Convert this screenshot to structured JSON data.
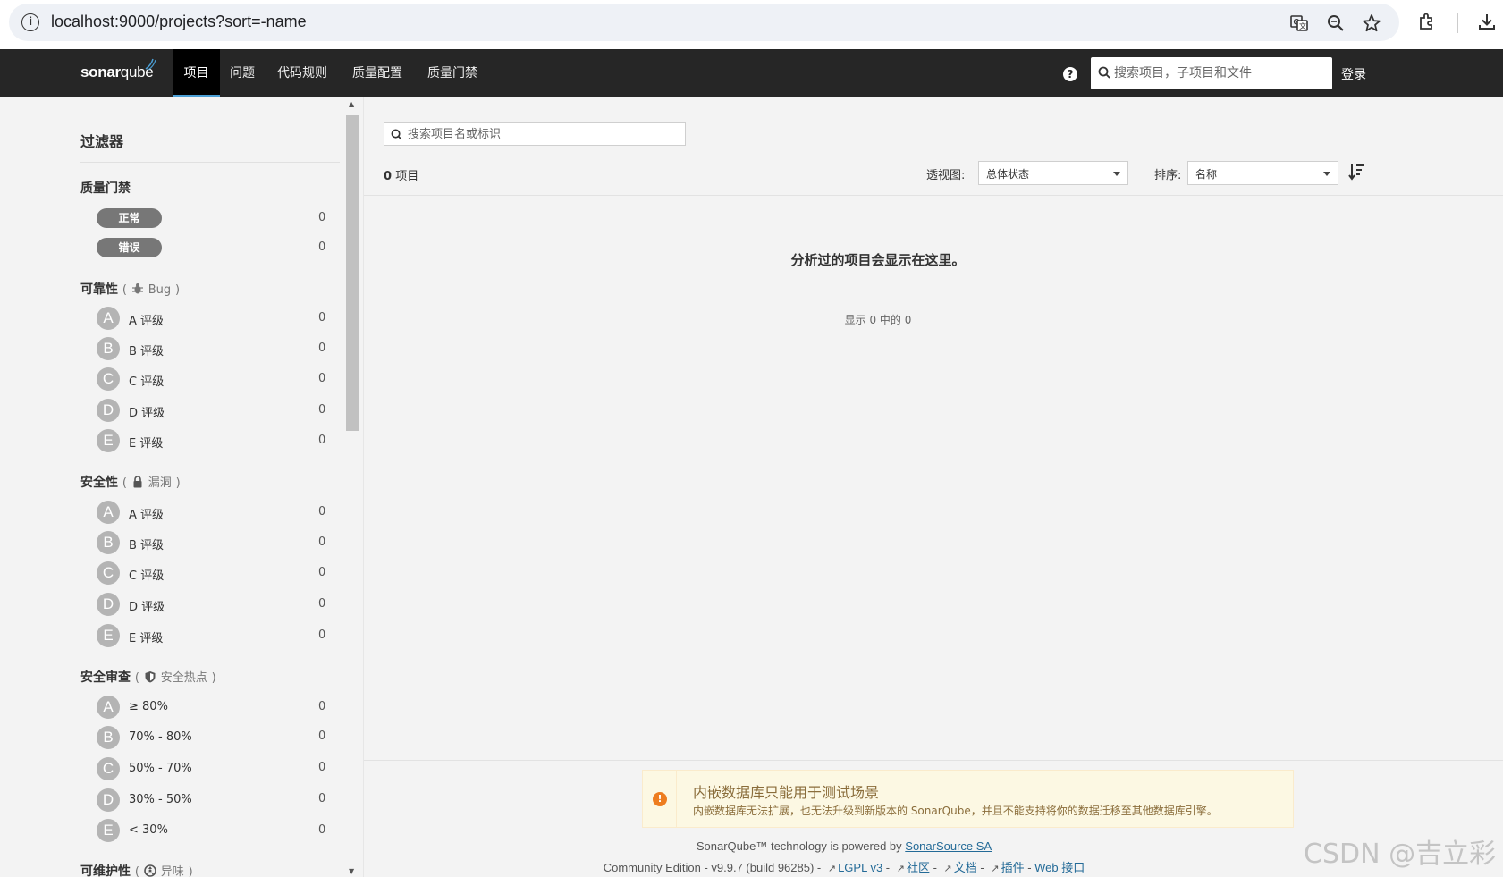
{
  "browser": {
    "url": "localhost:9000/projects?sort=-name"
  },
  "nav": {
    "logo_a": "sonar",
    "logo_b": "qube",
    "items": [
      {
        "label": "项目"
      },
      {
        "label": "问题"
      },
      {
        "label": "代码规则"
      },
      {
        "label": "质量配置"
      },
      {
        "label": "质量门禁"
      }
    ],
    "help": "?",
    "search_placeholder": "搜索项目，子项目和文件",
    "login": "登录"
  },
  "sidebar": {
    "title": "过滤器",
    "quality_gate": {
      "title": "质量门禁",
      "items": [
        {
          "label": "正常",
          "count": "0"
        },
        {
          "label": "错误",
          "count": "0"
        }
      ]
    },
    "reliability": {
      "title": "可靠性",
      "paren_open": "(",
      "sub": "Bug",
      "paren_close": ")",
      "items": [
        {
          "grade": "A",
          "label": "A 评级",
          "count": "0"
        },
        {
          "grade": "B",
          "label": "B 评级",
          "count": "0"
        },
        {
          "grade": "C",
          "label": "C 评级",
          "count": "0"
        },
        {
          "grade": "D",
          "label": "D 评级",
          "count": "0"
        },
        {
          "grade": "E",
          "label": "E 评级",
          "count": "0"
        }
      ]
    },
    "security": {
      "title": "安全性",
      "paren_open": "(",
      "sub": "漏洞",
      "paren_close": ")",
      "items": [
        {
          "grade": "A",
          "label": "A 评级",
          "count": "0"
        },
        {
          "grade": "B",
          "label": "B 评级",
          "count": "0"
        },
        {
          "grade": "C",
          "label": "C 评级",
          "count": "0"
        },
        {
          "grade": "D",
          "label": "D 评级",
          "count": "0"
        },
        {
          "grade": "E",
          "label": "E 评级",
          "count": "0"
        }
      ]
    },
    "security_review": {
      "title": "安全审查",
      "paren_open": "(",
      "sub": "安全热点",
      "paren_close": ")",
      "items": [
        {
          "grade": "A",
          "label": "≥ 80%",
          "count": "0"
        },
        {
          "grade": "B",
          "label": "70% - 80%",
          "count": "0"
        },
        {
          "grade": "C",
          "label": "50% - 70%",
          "count": "0"
        },
        {
          "grade": "D",
          "label": "30% - 50%",
          "count": "0"
        },
        {
          "grade": "E",
          "label": "< 30%",
          "count": "0"
        }
      ]
    },
    "maintainability": {
      "title": "可维护性",
      "paren_open": "(",
      "sub": "异味",
      "paren_close": ")"
    }
  },
  "main": {
    "search_placeholder": "搜索项目名或标识",
    "count_num": "0",
    "count_label": "项目",
    "perspective_label": "透视图:",
    "perspective_value": "总体状态",
    "sort_label": "排序:",
    "sort_value": "名称",
    "empty_message": "分析过的项目会显示在这里。",
    "showing": "显示 0 中的 0"
  },
  "warning": {
    "title": "内嵌数据库只能用于测试场景",
    "text": "内嵌数据库无法扩展，也无法升级到新版本的 SonarQube，并且不能支持将你的数据迁移至其他数据库引擎。"
  },
  "footer": {
    "powered_text": "SonarQube™ technology is powered by ",
    "powered_link": "SonarSource SA",
    "edition": "Community Edition - v9.9.7 (build 96285) - ",
    "links": [
      "LGPL v3",
      "社区",
      "文档",
      "插件"
    ],
    "sep": " - ",
    "web_api": "Web 接口"
  },
  "watermark": "CSDN @吉立彩"
}
